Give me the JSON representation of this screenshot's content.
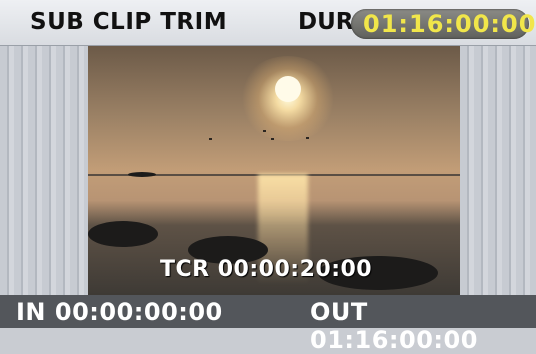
{
  "header": {
    "title": "SUB CLIP TRIM",
    "dur_label": "DUR",
    "dur_value": "01:16:00:00",
    "dur_value_color": "#f1e64a"
  },
  "video": {
    "timecode": "TCR 00:00:20:00"
  },
  "footer": {
    "in_point": "IN 00:00:00:00",
    "out_point": "OUT 01:16:00:00"
  }
}
